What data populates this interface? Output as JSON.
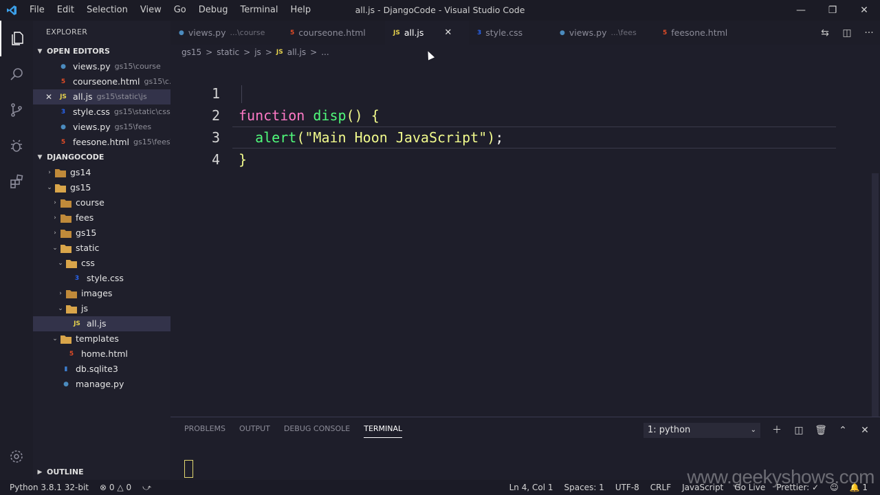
{
  "titlebar": {
    "menu": [
      "File",
      "Edit",
      "Selection",
      "View",
      "Go",
      "Debug",
      "Terminal",
      "Help"
    ],
    "window_title": "all.js - DjangoCode - Visual Studio Code"
  },
  "sidebar": {
    "explorer_label": "EXPLORER",
    "open_editors_label": "OPEN EDITORS",
    "open_editors": [
      {
        "name": "views.py",
        "desc": "gs15\\course",
        "type": "py"
      },
      {
        "name": "courseone.html",
        "desc": "gs15\\c...",
        "type": "html"
      },
      {
        "name": "all.js",
        "desc": "gs15\\static\\js",
        "type": "js"
      },
      {
        "name": "style.css",
        "desc": "gs15\\static\\css",
        "type": "css"
      },
      {
        "name": "views.py",
        "desc": "gs15\\fees",
        "type": "py"
      },
      {
        "name": "feesone.html",
        "desc": "gs15\\fees\\...",
        "type": "html"
      }
    ],
    "project_label": "DJANGOCODE",
    "tree": [
      {
        "name": "gs14",
        "depth": 0,
        "kind": "folder",
        "open": false
      },
      {
        "name": "gs15",
        "depth": 0,
        "kind": "folder",
        "open": true
      },
      {
        "name": "course",
        "depth": 1,
        "kind": "folder",
        "open": false
      },
      {
        "name": "fees",
        "depth": 1,
        "kind": "folder",
        "open": false
      },
      {
        "name": "gs15",
        "depth": 1,
        "kind": "folder",
        "open": false
      },
      {
        "name": "static",
        "depth": 1,
        "kind": "folder",
        "open": true
      },
      {
        "name": "css",
        "depth": 2,
        "kind": "folder",
        "open": true
      },
      {
        "name": "style.css",
        "depth": 3,
        "kind": "css"
      },
      {
        "name": "images",
        "depth": 2,
        "kind": "folder",
        "open": false
      },
      {
        "name": "js",
        "depth": 2,
        "kind": "folder",
        "open": true
      },
      {
        "name": "all.js",
        "depth": 3,
        "kind": "js"
      },
      {
        "name": "templates",
        "depth": 1,
        "kind": "folder",
        "open": true
      },
      {
        "name": "home.html",
        "depth": 2,
        "kind": "html"
      },
      {
        "name": "db.sqlite3",
        "depth": 1,
        "kind": "db"
      },
      {
        "name": "manage.py",
        "depth": 1,
        "kind": "py"
      }
    ],
    "outline_label": "OUTLINE"
  },
  "tabs": [
    {
      "name": "views.py",
      "desc": "...\\course",
      "type": "py"
    },
    {
      "name": "courseone.html",
      "desc": "",
      "type": "html"
    },
    {
      "name": "all.js",
      "desc": "",
      "type": "js"
    },
    {
      "name": "style.css",
      "desc": "",
      "type": "css"
    },
    {
      "name": "views.py",
      "desc": "...\\fees",
      "type": "py"
    },
    {
      "name": "feesone.html",
      "desc": "",
      "type": "html"
    }
  ],
  "breadcrumb": [
    "gs15",
    ">",
    "static",
    ">",
    "js",
    ">",
    "JS",
    "all.js",
    ">",
    "..."
  ],
  "editor": {
    "line_numbers": [
      "1",
      "2",
      "3",
      "4"
    ]
  },
  "panel": {
    "tabs": [
      "PROBLEMS",
      "OUTPUT",
      "DEBUG CONSOLE",
      "TERMINAL"
    ],
    "terminal_select": "1: python"
  },
  "statusbar": {
    "python": "Python 3.8.1 32-bit",
    "errors": "0",
    "warnings": "0",
    "position": "Ln 4, Col 1",
    "spaces": "Spaces: 1",
    "encoding": "UTF-8",
    "eol": "CRLF",
    "language": "JavaScript",
    "golive": "Go Live",
    "prettier": "Prettier: ✓",
    "notifications": "1"
  },
  "watermark": "www.geekyshows.com"
}
